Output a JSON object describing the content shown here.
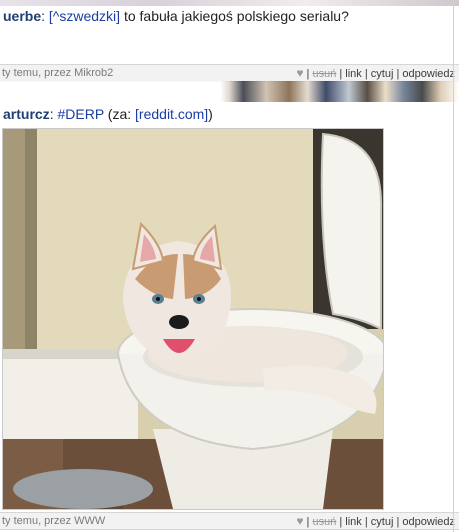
{
  "post1": {
    "author": "uerbe",
    "separator": ":",
    "reply_to": "[^szwedzki]",
    "text": " to fabuła jakiegoś polskiego serialu?",
    "meta": {
      "time_author": "ty temu, przez Mikrob2",
      "heart": "♥",
      "delete": "usuń",
      "link": "link",
      "quote": "cytuj",
      "reply": "odpowiedz"
    }
  },
  "post2": {
    "author": "arturcz",
    "separator": ":",
    "tag": "#DERP",
    "source_prefix": " (za: ",
    "source_link": "[reddit.com]",
    "source_suffix": ")",
    "image_alt": "husky puppy sitting in a toilet bowl",
    "meta": {
      "time_author": "ty temu, przez WWW",
      "heart": "♥",
      "delete": "usuń",
      "link": "link",
      "quote": "cytuj",
      "reply": "odpowiedz"
    }
  },
  "meta_separator": " | ",
  "colors": {
    "author": "#1f3f73",
    "link": "#1a3ea3",
    "meta_bg": "#f2f2f2"
  }
}
